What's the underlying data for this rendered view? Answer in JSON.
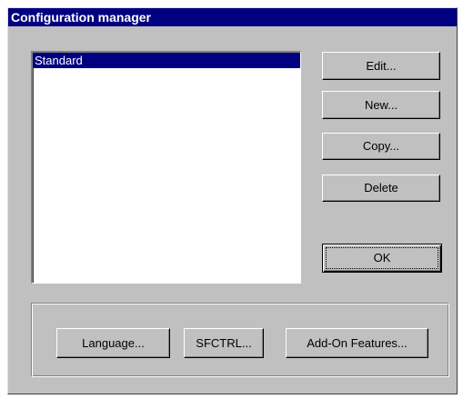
{
  "window": {
    "title": "Configuration manager"
  },
  "config_list": {
    "items": [
      "Standard"
    ],
    "selected_index": 0
  },
  "buttons": {
    "edit": "Edit...",
    "new": "New...",
    "copy": "Copy...",
    "delete": "Delete",
    "ok": "OK",
    "language": "Language...",
    "sfctrl": "SFCTRL...",
    "addon_features": "Add-On Features..."
  },
  "colors": {
    "titlebar": "#000080",
    "dialog_face": "#c0c0c0",
    "selection": "#000080"
  }
}
